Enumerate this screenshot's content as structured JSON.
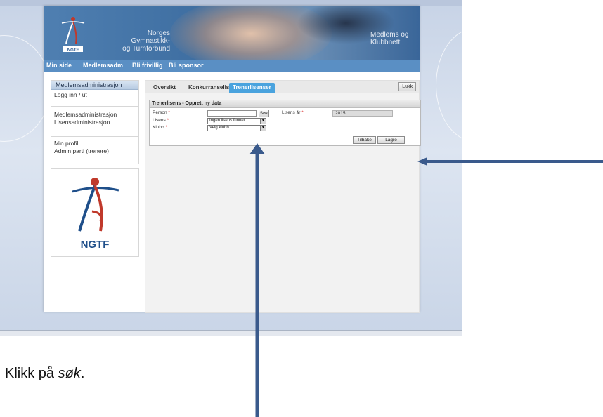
{
  "header": {
    "org_line1": "Norges Gymnastikk-",
    "org_line2": "og Turnforbund",
    "logo_text": "NGTF",
    "right_line1": "Medlems og",
    "right_line2": "Klubbnett"
  },
  "nav": {
    "items": [
      {
        "label": "Min side"
      },
      {
        "label": "Medlemsadm"
      },
      {
        "label": "Bli frivillig"
      },
      {
        "label": "Bli sponsor"
      }
    ]
  },
  "sidebar": {
    "box1_title": "Medlemsadministrasjon",
    "box1_link": "Logg inn / ut",
    "box2_links": [
      "Medlemsadministrasjon",
      "Lisensadministrasjon"
    ],
    "box3_links": [
      "Min profil",
      "Admin parti (trenere)"
    ],
    "logo_text": "NGTF"
  },
  "main": {
    "tabs": [
      {
        "label": "Oversikt"
      },
      {
        "label": "Konkurranselisenser"
      },
      {
        "label": "Trenerlisenser",
        "active": true
      }
    ],
    "close_label": "Lukk",
    "form": {
      "title": "Trenerlisens - Opprett ny data",
      "person_label": "Person",
      "search_label": "Søk",
      "lisens_label": "Lisens",
      "lisens_value": "Ingen lisens funnet",
      "klubb_label": "Klubb",
      "klubb_value": "Velg klubb",
      "lisens_year_label": "Lisens år",
      "lisens_year_value": "2015",
      "required_marker": "*",
      "back_label": "Tilbake",
      "save_label": "Lagre"
    }
  },
  "annotation": {
    "caption_prefix": "Klikk på ",
    "caption_em": "søk",
    "caption_suffix": ".",
    "arrow_color": "#3a5a8c"
  },
  "colors": {
    "header_blue": "#4f7fb1",
    "nav_blue": "#5a8fc4",
    "active_tab": "#4aa3de",
    "logo_red": "#c0392b",
    "logo_blue": "#1f4f8a"
  }
}
